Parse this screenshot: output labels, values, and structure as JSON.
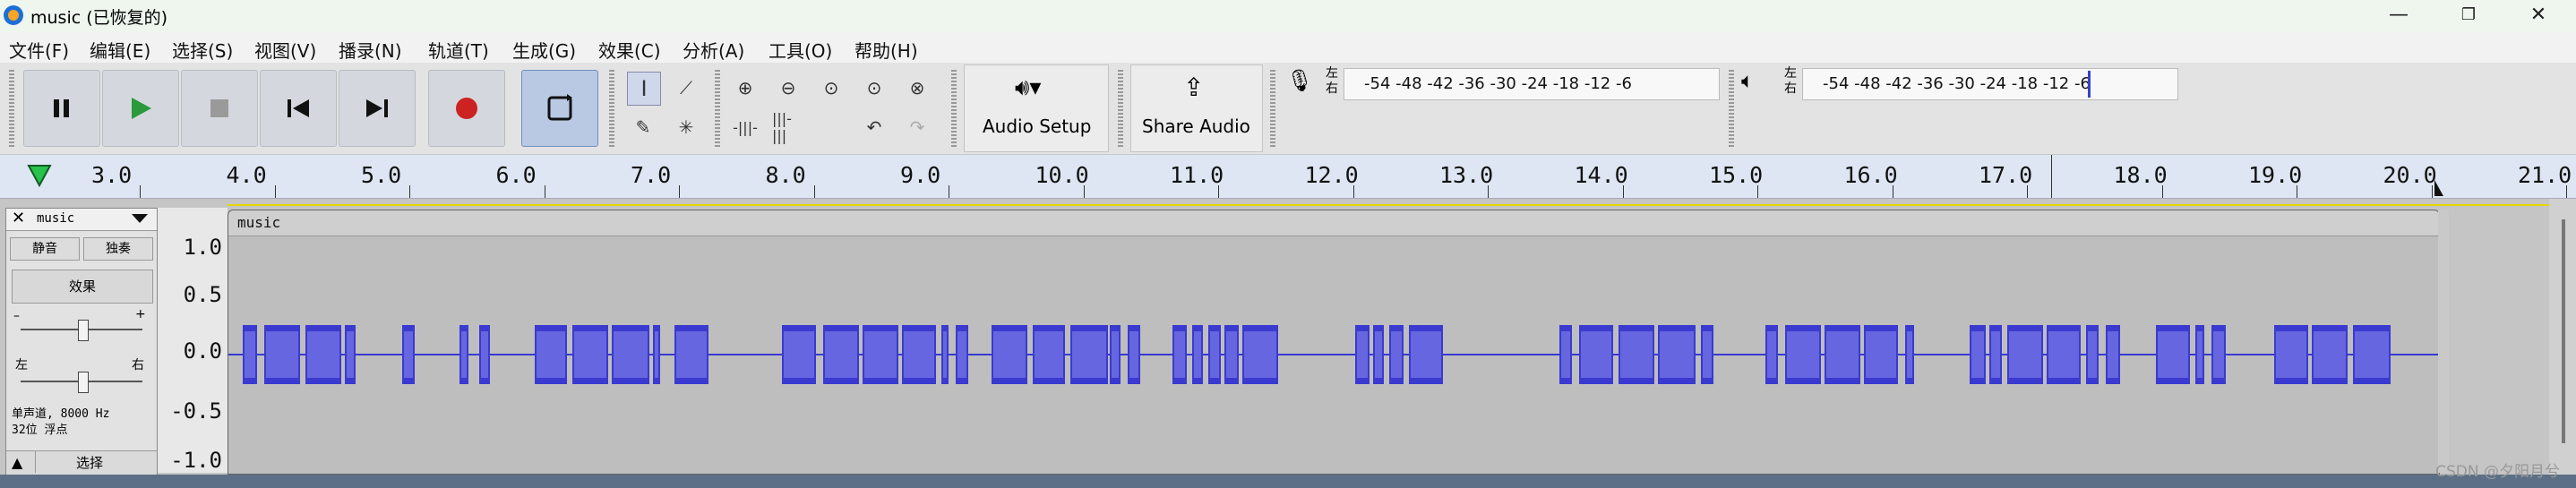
{
  "window": {
    "title": "music (已恢复的)",
    "minimize": "—",
    "restore": "❐",
    "close": "✕"
  },
  "menu": [
    {
      "label": "文件(F)"
    },
    {
      "label": "编辑(E)"
    },
    {
      "label": "选择(S)"
    },
    {
      "label": "视图(V)"
    },
    {
      "label": "播录(N)"
    },
    {
      "label": "轨道(T)"
    },
    {
      "label": "生成(G)"
    },
    {
      "label": "效果(C)"
    },
    {
      "label": "分析(A)"
    },
    {
      "label": "工具(O)"
    },
    {
      "label": "帮助(H)"
    }
  ],
  "toolbar": {
    "audio_setup_label": "Audio Setup",
    "share_audio_label": "Share Audio",
    "rec_meter": {
      "lr": [
        "左",
        "右"
      ],
      "ticks": "-54 -48 -42 -36 -30 -24 -18 -12  -6"
    },
    "play_meter": {
      "lr": [
        "左",
        "右"
      ],
      "ticks": "-54 -48 -42 -36 -30 -24 -18 -12  -6"
    }
  },
  "ruler": {
    "labels": [
      "3.0",
      "4.0",
      "5.0",
      "6.0",
      "7.0",
      "8.0",
      "9.0",
      "10.0",
      "11.0",
      "12.0",
      "13.0",
      "14.0",
      "15.0",
      "16.0",
      "17.0",
      "18.0",
      "19.0",
      "20.0",
      "21.0"
    ]
  },
  "track": {
    "name": "music",
    "mute_label": "静音",
    "solo_label": "独奏",
    "effects_label": "效果",
    "gain_minus": "–",
    "gain_plus": "+",
    "pan_left": "左",
    "pan_right": "右",
    "info_line1": "单声道, 8000 Hz",
    "info_line2": "32位 浮点",
    "select_label": "选择",
    "collapse_icon": "▲"
  },
  "scale": [
    "1.0",
    "0.5",
    "0.0",
    "-0.5",
    "-1.0"
  ],
  "clip": {
    "name": "music"
  },
  "colors": {
    "waveform": "#3a3ad0",
    "waveform_inner": "#6666e0",
    "ruler_bg": "#dde6f2"
  },
  "watermark": "CSDN @夕阳月兮"
}
